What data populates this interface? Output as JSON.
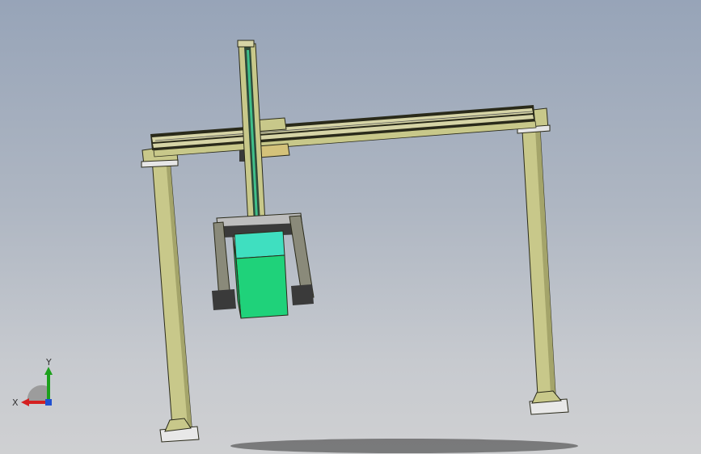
{
  "viewport": {
    "background_top": "#97a4b8",
    "background_bottom": "#cfd0d2"
  },
  "model": {
    "frame_color": "#c8c88a",
    "frame_edge": "#2a2a1a",
    "rail_color": "#d6d4a6",
    "container_color": "#1fd27a",
    "container_top": "#3fdfc0",
    "gripper_color": "#3a3a3a"
  },
  "triad": {
    "x_label": "X",
    "y_label": "Y",
    "x_color": "#d42020",
    "y_color": "#1ca01c",
    "z_color": "#2050d0"
  }
}
